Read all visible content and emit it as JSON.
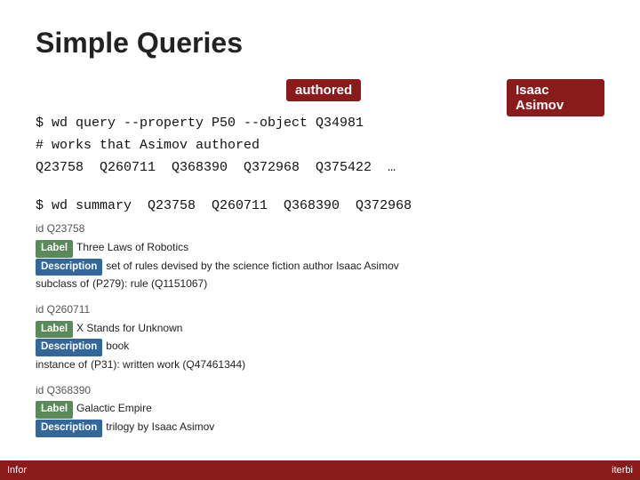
{
  "slide": {
    "title": "Simple Queries",
    "badges": {
      "authored": "authored",
      "isaac": "Isaac Asimov"
    },
    "code": {
      "line1": "$ wd query --property P50 --object Q34981",
      "line2": "# works that Asimov authored",
      "line3": "Q23758  Q260711  Q368390  Q372968  Q375422  …"
    },
    "summary_cmd": "$ wd summary  Q23758  Q260711  Q368390  Q372968",
    "entries": [
      {
        "id": "id Q23758",
        "label_text": "Three Laws of Robotics",
        "desc_text": "set of rules devised by the science fiction author Isaac Asimov",
        "extra_key": "subclass of",
        "extra_val": "(P279): rule (Q1151067)"
      },
      {
        "id": "id Q260711",
        "label_text": "X Stands for Unknown",
        "desc_text": "book",
        "extra_key": "instance of",
        "extra_val": "(P31): written work (Q47461344)"
      },
      {
        "id": "id Q368390",
        "label_text": "Galactic Empire",
        "desc_text": "trilogy by Isaac Asimov",
        "extra_key": "",
        "extra_val": ""
      }
    ],
    "bottom_left": "Infor",
    "bottom_right": "iterbi"
  }
}
